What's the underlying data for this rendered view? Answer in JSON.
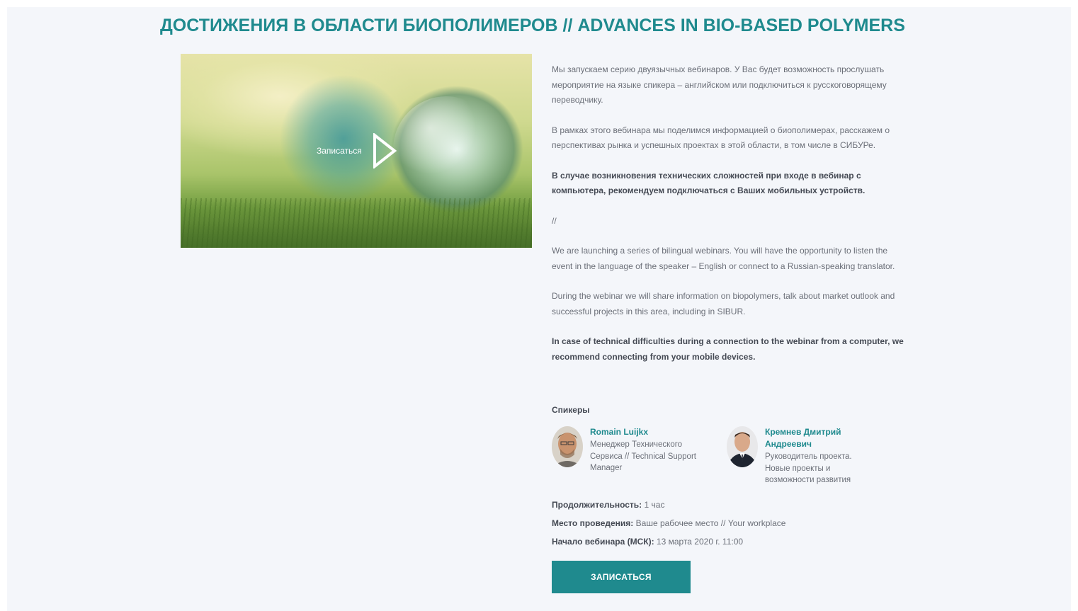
{
  "page": {
    "title": "ДОСТИЖЕНИЯ В ОБЛАСТИ БИОПОЛИМЕРОВ // ADVANCES IN BIO-BASED POLYMERS"
  },
  "hero": {
    "label": "Записаться",
    "play_icon": "play-icon"
  },
  "description": {
    "ru_p1": "Мы запускаем серию двуязычных вебинаров. У Вас будет возможность прослушать мероприятие на языке спикера – английском или подключиться к русскоговорящему переводчику.",
    "ru_p2": "В рамках этого вебинара мы поделимся информацией о биополимерах, расскажем о перспективах рынка и успешных проектах в этой области, в том числе в СИБУРе.",
    "ru_note": "В случае возникновения технических сложностей при входе в вебинар с компьютера, рекомендуем подключаться с Ваших мобильных устройств.",
    "separator": "//",
    "en_p1": "We are launching a series of bilingual webinars. You will have the opportunity to listen the event in the language of the speaker – English or connect to a Russian-speaking translator.",
    "en_p2": "During the webinar we will share information on biopolymers, talk about market outlook and successful projects in this area, including in SIBUR.",
    "en_note": "In case of technical difficulties during a connection to the webinar from a computer, we recommend connecting from your mobile devices."
  },
  "speakers": {
    "title": "Спикеры",
    "items": [
      {
        "name": "Romain Luijkx",
        "role": "Менеджер Технического Сервиса // Technical Support Manager"
      },
      {
        "name": "Кремнев Дмитрий Андреевич",
        "role": "Руководитель проекта. Новые проекты и возможности развития"
      }
    ]
  },
  "meta": {
    "duration_label": "Продолжительность:",
    "duration_value": "1 час",
    "venue_label": "Место проведения:",
    "venue_value": "Ваше рабочее место // Your workplace",
    "start_label": "Начало вебинара (МСК):",
    "start_value": "13 марта 2020 г. 11:00"
  },
  "cta": {
    "label": "ЗАПИСАТЬСЯ"
  },
  "colors": {
    "accent": "#1f8a8e",
    "background": "#f4f6fa",
    "text": "#6b6f78",
    "text_strong": "#454a54"
  }
}
